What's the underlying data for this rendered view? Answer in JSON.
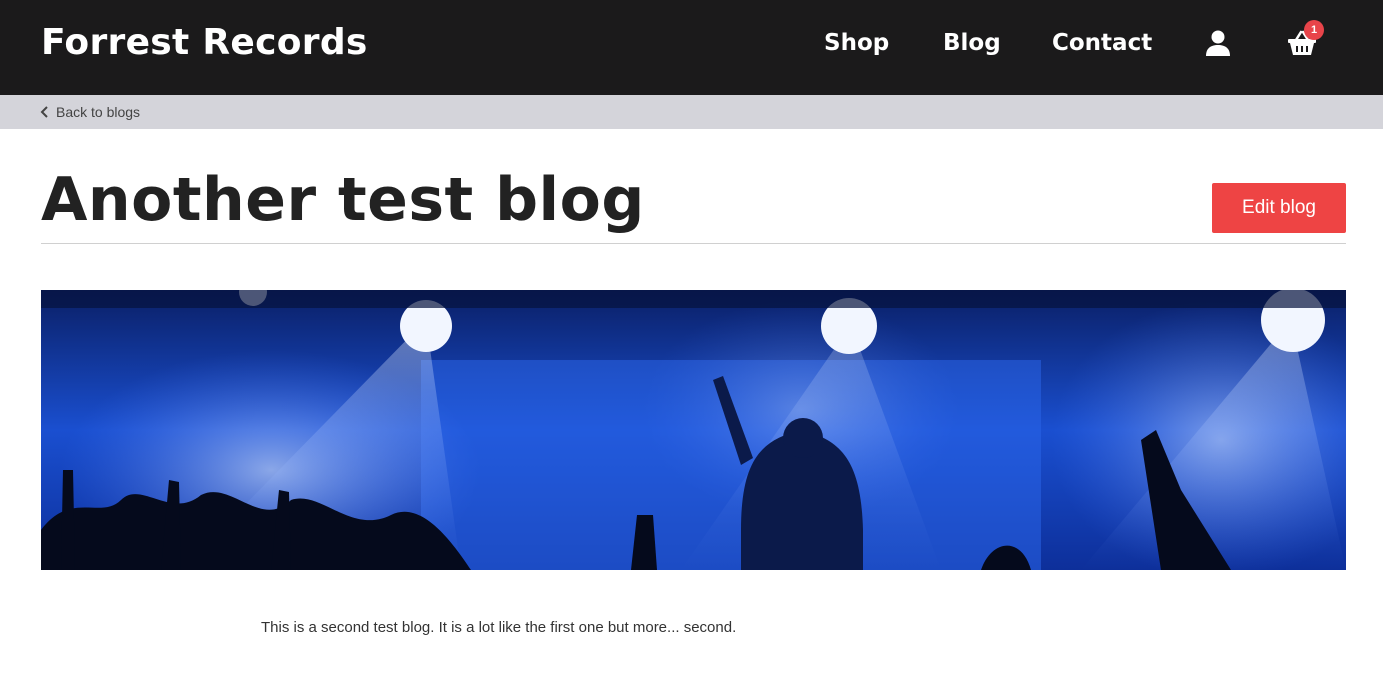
{
  "brand": "Forrest Records",
  "nav": {
    "shop": "Shop",
    "blog": "Blog",
    "contact": "Contact",
    "account_icon": "user-icon",
    "cart_icon": "basket-icon",
    "cart_count": "1"
  },
  "breadcrumb": {
    "back_label": "Back to blogs",
    "icon": "chevron-left-icon"
  },
  "post": {
    "title": "Another test blog",
    "edit_label": "Edit blog",
    "image_description": "concert stage with blue lights and crowd",
    "body": "This is a second test blog. It is a lot like the first one but more... second."
  },
  "colors": {
    "navbar": "#1b1a1b",
    "subbar": "#d4d4da",
    "accent": "#ee4444"
  }
}
